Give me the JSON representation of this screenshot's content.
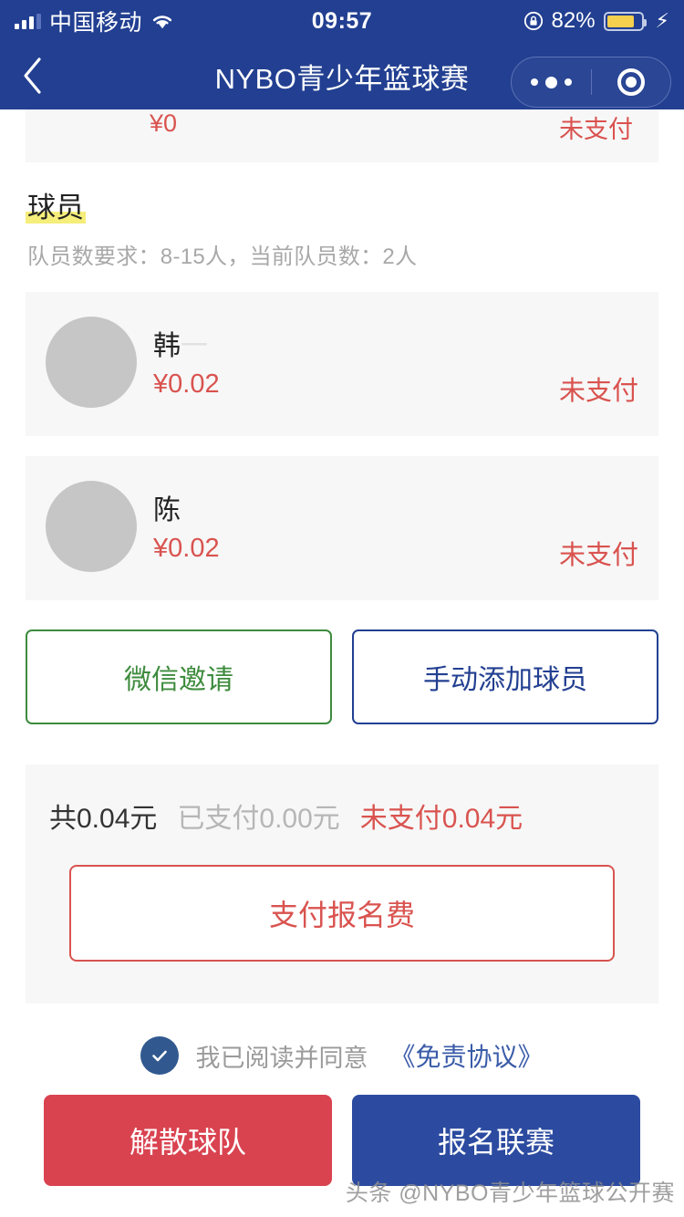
{
  "status_bar": {
    "carrier": "中国移动",
    "time": "09:57",
    "battery_percent": "82%",
    "icons": {
      "signal": "signal-bars-icon",
      "wifi": "wifi-icon",
      "rotation_lock": "rotation-lock-icon",
      "battery": "battery-icon",
      "charging": "lightning-bolt-icon"
    }
  },
  "navbar": {
    "title": "NYBO青少年篮球赛",
    "back_icon": "chevron-left-icon",
    "more_icon": "more-dots-icon",
    "target_icon": "target-circle-icon"
  },
  "top_partial_card": {
    "amount": "¥0",
    "status": "未支付"
  },
  "players_section": {
    "title": "球员",
    "highlight_color": "#f5ee7a",
    "subtitle": "队员数要求：8-15人，当前队员数：2人",
    "rows": [
      {
        "name": "韩",
        "name_faded": "一",
        "amount": "¥0.02",
        "status": "未支付"
      },
      {
        "name": "陈",
        "name_faded": "",
        "amount": "¥0.02",
        "status": "未支付"
      }
    ]
  },
  "invite_buttons": {
    "wechat_invite": "微信邀请",
    "manual_add": "手动添加球员",
    "wechat_color": "#3d8b3d",
    "manual_color": "#223f91"
  },
  "summary": {
    "total": "共0.04元",
    "paid": "已支付0.00元",
    "unpaid": "未支付0.04元",
    "pay_button": "支付报名费",
    "pay_color": "#d9534f"
  },
  "agreement": {
    "checked": true,
    "text": "我已阅读并同意",
    "link": "《免责协议》",
    "check_color": "#31598f",
    "link_color": "#3a5ba8"
  },
  "bottom_actions": {
    "disband": "解散球队",
    "register": "报名联赛",
    "disband_color": "#d94350",
    "register_color": "#2c4ba0"
  },
  "watermark": {
    "text": "头条 @NYBO青少年篮球公开赛"
  },
  "theme": {
    "nav_background": "#223f91",
    "card_background": "#f7f7f7",
    "red": "#d9534f"
  }
}
